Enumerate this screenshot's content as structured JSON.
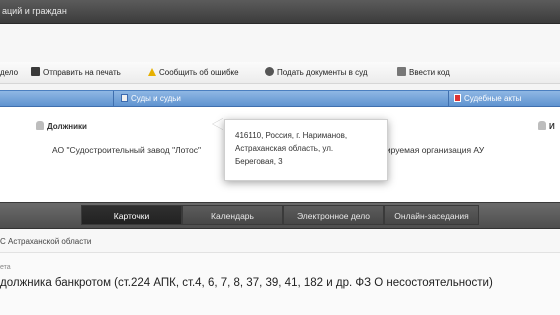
{
  "window": {
    "title": "аций и граждан"
  },
  "toolbar": {
    "items": [
      {
        "label": "дело",
        "icon": ""
      },
      {
        "label": "Отправить на печать",
        "icon": "printer-icon"
      },
      {
        "label": "Сообщить об ошибке",
        "icon": "warning-icon"
      },
      {
        "label": "Подать документы в суд",
        "icon": "gear-icon"
      },
      {
        "label": "Ввести код",
        "icon": "key-icon"
      }
    ]
  },
  "section_bar": {
    "courts_label": "Суды и судьи",
    "acts_label": "Судебные акты"
  },
  "participants": {
    "debtor_heading": "Должники",
    "debtor_name": "АО \"Судостроительный завод \"Лотос\"",
    "right_heading": "И",
    "right_text": "тируемая организация АУ"
  },
  "tooltip": {
    "lines": [
      "416110, Россия, г. Нариманов,",
      "Астраханская область, ул.",
      "Береговая, 3"
    ]
  },
  "nav_tabs": [
    {
      "label": "Карточки",
      "active": true
    },
    {
      "label": "Календарь",
      "active": false
    },
    {
      "label": "Электронное дело",
      "active": false
    },
    {
      "label": "Онлайн-заседания",
      "active": false
    }
  ],
  "court": {
    "name": "С Астраханской области"
  },
  "case": {
    "small_label": "ета",
    "subject": "должника банкротом (ст.224 АПК, ст.4, 6, 7, 8, 37, 39, 41, 182 и др. ФЗ О несостоятельности)"
  },
  "colors": {
    "section_blue": "#6a9ad4",
    "nav_dark": "#555555",
    "active_tab": "#262626"
  }
}
